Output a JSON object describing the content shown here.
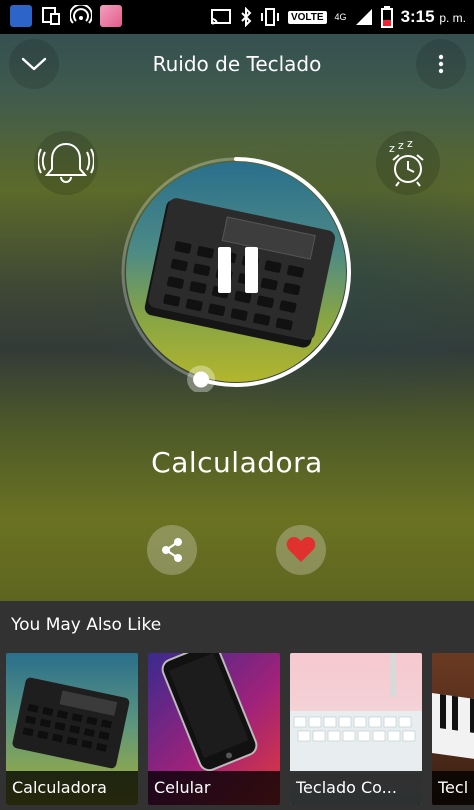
{
  "status_bar": {
    "volte": "VOLTE",
    "network": "4G",
    "time": "3:15",
    "ampm": "p. m."
  },
  "header": {
    "title": "Ruido de Teclado"
  },
  "player": {
    "track_name": "Calculadora",
    "progress": 0.55,
    "state": "playing"
  },
  "recommendations": {
    "heading": "You May Also Like",
    "items": [
      {
        "label": "Calculadora"
      },
      {
        "label": "Celular"
      },
      {
        "label": "Teclado Co..."
      },
      {
        "label": "Tecl"
      }
    ]
  },
  "colors": {
    "accent_heart": "#e0312f",
    "bottom_panel": "#323232"
  }
}
